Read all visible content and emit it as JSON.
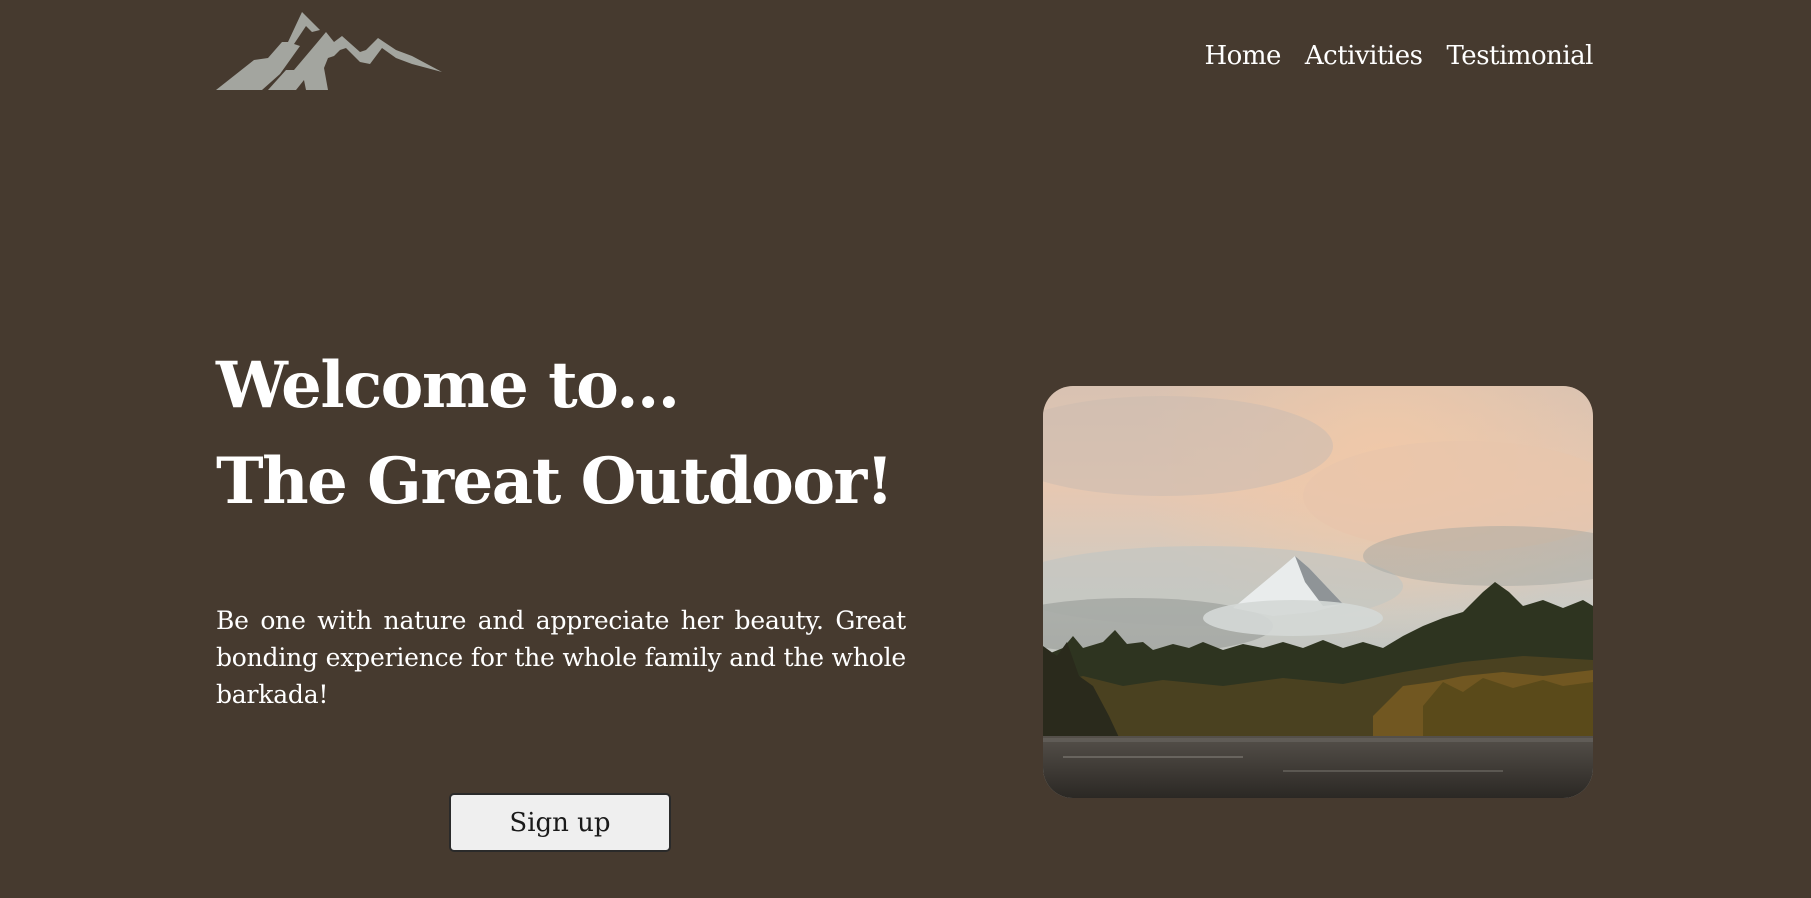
{
  "nav": {
    "items": [
      "Home",
      "Activities",
      "Testimonial"
    ]
  },
  "hero": {
    "title_line1": "Welcome to...",
    "title_line2": "The Great Outdoor!",
    "description": "Be one with nature and appreciate her beauty. Great bonding experience for the whole family and the whole barkada!",
    "cta_label": "Sign up"
  },
  "image": {
    "subject": "snow-capped mountain behind forest and lake"
  },
  "colors": {
    "background": "#463a2f",
    "text": "#ffffff",
    "logo": "#a3a59f",
    "button_bg": "#efefef"
  }
}
